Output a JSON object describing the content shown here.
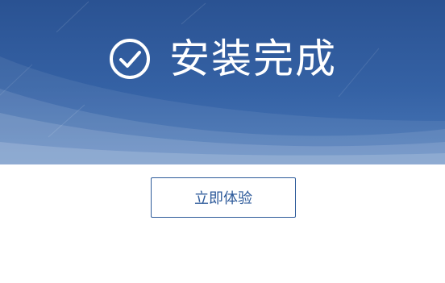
{
  "colors": {
    "banner_dark": "#2a5292",
    "banner_light": "#6b8fc4",
    "accent": "#2d5a9a",
    "background": "#ffffff"
  },
  "banner": {
    "icon": "check-circle-icon",
    "title": "安装完成"
  },
  "actions": {
    "primary_label": "立即体验"
  }
}
